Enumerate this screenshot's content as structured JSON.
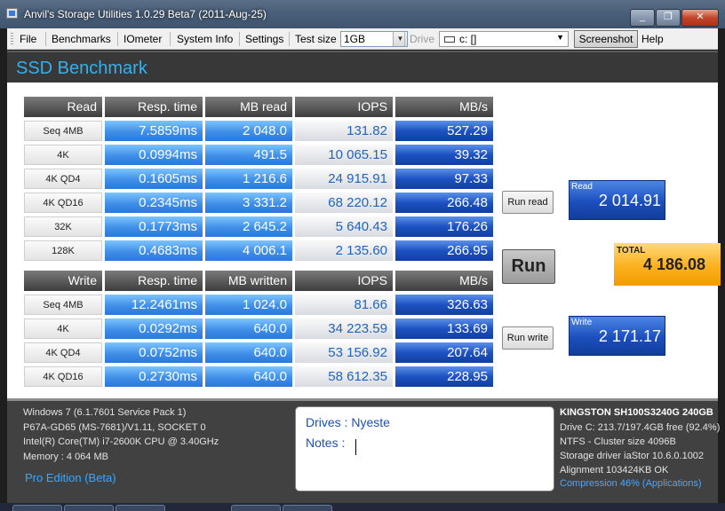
{
  "window": {
    "title": "Anvil's Storage Utilities 1.0.29 Beta7 (2011-Aug-25)"
  },
  "menu": {
    "file": "File",
    "benchmarks": "Benchmarks",
    "iometer": "IOmeter",
    "system_info": "System Info",
    "settings": "Settings",
    "test_size_label": "Test size",
    "test_size_value": "1GB",
    "drive_label": "Drive",
    "drive_value": "c: []",
    "screenshot": "Screenshot",
    "help": "Help"
  },
  "header": {
    "title": "SSD Benchmark"
  },
  "read": {
    "headers": [
      "Read",
      "Resp. time",
      "MB read",
      "IOPS",
      "MB/s"
    ],
    "rows": [
      {
        "label": "Seq 4MB",
        "resp": "7.5859ms",
        "mb": "2 048.0",
        "iops": "131.82",
        "mbs": "527.29"
      },
      {
        "label": "4K",
        "resp": "0.0994ms",
        "mb": "491.5",
        "iops": "10 065.15",
        "mbs": "39.32"
      },
      {
        "label": "4K QD4",
        "resp": "0.1605ms",
        "mb": "1 216.6",
        "iops": "24 915.91",
        "mbs": "97.33"
      },
      {
        "label": "4K QD16",
        "resp": "0.2345ms",
        "mb": "3 331.2",
        "iops": "68 220.12",
        "mbs": "266.48"
      },
      {
        "label": "32K",
        "resp": "0.1773ms",
        "mb": "2 645.2",
        "iops": "5 640.43",
        "mbs": "176.26"
      },
      {
        "label": "128K",
        "resp": "0.4683ms",
        "mb": "4 006.1",
        "iops": "2 135.60",
        "mbs": "266.95"
      }
    ]
  },
  "write": {
    "headers": [
      "Write",
      "Resp. time",
      "MB written",
      "IOPS",
      "MB/s"
    ],
    "rows": [
      {
        "label": "Seq 4MB",
        "resp": "12.2461ms",
        "mb": "1 024.0",
        "iops": "81.66",
        "mbs": "326.63"
      },
      {
        "label": "4K",
        "resp": "0.0292ms",
        "mb": "640.0",
        "iops": "34 223.59",
        "mbs": "133.69"
      },
      {
        "label": "4K QD4",
        "resp": "0.0752ms",
        "mb": "640.0",
        "iops": "53 156.92",
        "mbs": "207.64"
      },
      {
        "label": "4K QD16",
        "resp": "0.2730ms",
        "mb": "640.0",
        "iops": "58 612.35",
        "mbs": "228.95"
      }
    ]
  },
  "buttons": {
    "run_read": "Run read",
    "run": "Run",
    "run_write": "Run write"
  },
  "scores": {
    "read_label": "Read",
    "read_value": "2 014.91",
    "total_label": "TOTAL",
    "total_value": "4 186.08",
    "write_label": "Write",
    "write_value": "2 171.17"
  },
  "system": {
    "os": "Windows 7 (6.1.7601 Service Pack 1)",
    "board": "P67A-GD65 (MS-7681)/V1.11, SOCKET 0",
    "cpu": "Intel(R) Core(TM) i7-2600K CPU @ 3.40GHz",
    "memory": "Memory : 4 064 MB",
    "edition": "Pro Edition (Beta)"
  },
  "notes": {
    "drives": "Drives : Nyeste",
    "notes": "Notes :"
  },
  "drive_info": {
    "model": "KINGSTON SH100S3240G 240GB",
    "drive": "Drive C: 213.7/197.4GB free (92.4%)",
    "ntfs": "NTFS - Cluster size 4096B",
    "storage_driver": "Storage driver  iaStor 10.6.0.1002",
    "alignment": "Alignment 103424KB OK",
    "compression": "Compression 46% (Applications)"
  }
}
